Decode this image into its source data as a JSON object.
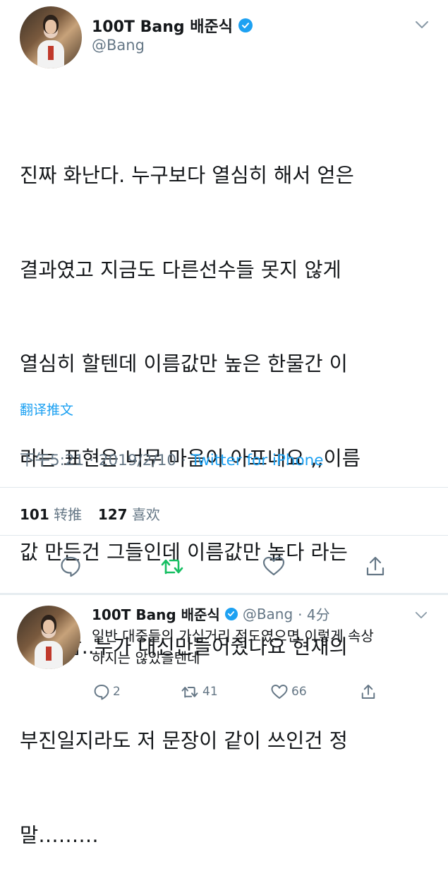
{
  "tweet": {
    "display_name": "100T Bang 배준식",
    "handle": "@Bang",
    "lines": [
      "진짜 화난다. 누구보다 열심히 해서 얻은",
      "결과였고 지금도 다른선수들 못지 않게",
      "열심히 할텐데 이름값만 높은 한물간 이",
      "라는 표현은 너무 마음이 아프네요 ,,이름",
      "값 만든건 그들인데 이름값만 높다 라는",
      "말이 참..누가 대신만들어줬나요 현재의",
      "부진일지라도 저 문장이 같이 쓰인건 정",
      "말………"
    ],
    "translate_label": "翻译推文",
    "time": "下午5:21",
    "date": "2019/2/10",
    "dot": "·",
    "source": "Twitter for iPhone",
    "retweet_count": "101",
    "retweet_label": "转推",
    "like_count": "127",
    "like_label": "喜欢"
  },
  "reply": {
    "display_name": "100T Bang 배준식",
    "handle": "@Bang",
    "age": "· 4分",
    "lines": [
      "일반 대중들의 가십거리 정도였으면 이렇게 속상",
      "하지는 않았을텐데"
    ],
    "reply_count": "2",
    "retweet_count": "41",
    "like_count": "66"
  },
  "colors": {
    "accent": "#1da1f2",
    "retweet_green": "#17bf63",
    "secondary_text": "#657786",
    "divider": "#e1e8ed"
  },
  "icons": [
    "verified-badge-icon",
    "chevron-down-icon",
    "reply-icon",
    "retweet-icon",
    "like-icon",
    "share-icon"
  ]
}
